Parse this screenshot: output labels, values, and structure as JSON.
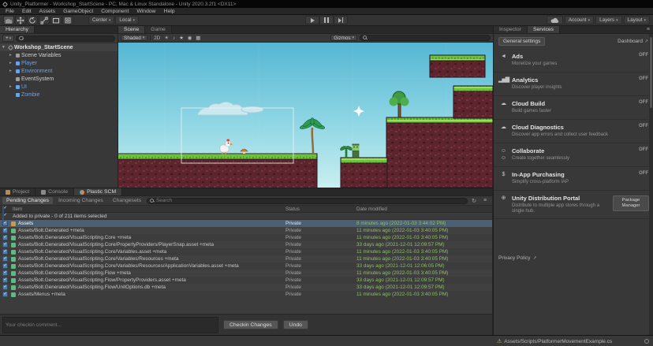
{
  "window": {
    "title": "Unity_Platformer - Workshop_StartScene - PC, Mac & Linux Standalone - Unity 2020.3.2f1 <DX11>"
  },
  "menu": {
    "items": [
      "File",
      "Edit",
      "Assets",
      "GameObject",
      "Component",
      "Window",
      "Help"
    ]
  },
  "toolbar": {
    "pivot_label": "Center",
    "space_label": "Local",
    "account_label": "Account",
    "layers_label": "Layers",
    "layout_label": "Layout"
  },
  "hierarchy": {
    "tab_label": "Hierarchy",
    "create_label": "+",
    "scene_name": "Workshop_StartScene",
    "search_placeholder": "",
    "items": [
      {
        "label": "Scene Variables",
        "label_cls": "",
        "arrow": "▸"
      },
      {
        "label": "Player",
        "label_cls": "blue",
        "arrow": "▸"
      },
      {
        "label": "Environment",
        "label_cls": "blue",
        "arrow": "▸"
      },
      {
        "label": "EventSystem",
        "label_cls": "",
        "arrow": ""
      },
      {
        "label": "UI",
        "label_cls": "blue",
        "arrow": "▸"
      },
      {
        "label": "Zombie",
        "label_cls": "blue",
        "arrow": ""
      }
    ]
  },
  "scene_view": {
    "scene_tab": "Scene",
    "game_tab": "Game",
    "draw_mode": "Shaded",
    "toggle_2d": "2D",
    "gizmos_label": "Gizmos",
    "search_placeholder": ""
  },
  "bottom_panel": {
    "project_tab": "Project",
    "console_tab": "Console",
    "plastic_tab": "Plastic SCM",
    "subtabs": [
      {
        "label": "Pending Changes",
        "cls": "active"
      },
      {
        "label": "Incoming Changes",
        "cls": ""
      },
      {
        "label": "Changesets",
        "cls": ""
      }
    ],
    "search_placeholder": "Search",
    "columns": {
      "item": "Item",
      "status": "Status",
      "date": "Date modified"
    },
    "group_row": "Added to private - 0 of 211 items selected",
    "rows": [
      {
        "item": "Assets",
        "status": "Private",
        "date": "8 minutes ago (2022-01-03 3:44:02 PM)",
        "row_cls": "selected",
        "icon_cls": "folder"
      },
      {
        "item": "Assets/Bolt.Generated +meta",
        "status": "Private",
        "date": "11 minutes ago (2022-01-03 3:40:05 PM)"
      },
      {
        "item": "Assets/Bolt.Generated/VisualScripting.Core +meta",
        "status": "Private",
        "date": "11 minutes ago (2022-01-03 3:40:05 PM)"
      },
      {
        "item": "Assets/Bolt.Generated/VisualScripting.Core/PropertyProviders/PlayerSnap.asset +meta",
        "status": "Private",
        "date": "33 days ago (2021-12-01 12:09:57 PM)"
      },
      {
        "item": "Assets/Bolt.Generated/VisualScripting.Core/Variables.asset +meta",
        "status": "Private",
        "date": "11 minutes ago (2022-01-03 3:40:05 PM)"
      },
      {
        "item": "Assets/Bolt.Generated/VisualScripting.Core/Variables/Resources +meta",
        "status": "Private",
        "date": "11 minutes ago (2022-01-03 3:40:05 PM)"
      },
      {
        "item": "Assets/Bolt.Generated/VisualScripting.Core/Variables/Resources/ApplicationVariables.asset +meta",
        "status": "Private",
        "date": "33 days ago (2021-12-01 12:06:05 PM)"
      },
      {
        "item": "Assets/Bolt.Generated/VisualScripting.Flow +meta",
        "status": "Private",
        "date": "11 minutes ago (2022-01-03 3:40:05 PM)"
      },
      {
        "item": "Assets/Bolt.Generated/VisualScripting.Flow/PropertyProviders.asset +meta",
        "status": "Private",
        "date": "33 days ago (2021-12-01 12:09:57 PM)"
      },
      {
        "item": "Assets/Bolt.Generated/VisualScripting.Flow/UnitOptions.db +meta",
        "status": "Private",
        "date": "33 days ago (2021-12-01 12:09:57 PM)"
      },
      {
        "item": "Assets/Menus +meta",
        "status": "Private",
        "date": "11 minutes ago (2022-01-03 3:40:05 PM)"
      }
    ],
    "comment_placeholder": "Your checkin comment...",
    "checkin_button": "Checkin Changes",
    "undo_button": "Undo"
  },
  "services": {
    "inspector_tab": "Inspector",
    "services_tab": "Services",
    "general_settings_label": "General settings",
    "dashboard_label": "Dashboard",
    "items": [
      {
        "name": "Ads",
        "desc": "Monetize your games",
        "status": "OFF",
        "icon": "megaphone-icon",
        "glyph": "◄"
      },
      {
        "name": "Analytics",
        "desc": "Discover player insights",
        "status": "OFF",
        "icon": "bar-chart-icon",
        "glyph": "▂▅▇"
      },
      {
        "name": "Cloud Build",
        "desc": "Build games faster",
        "status": "OFF",
        "icon": "cloud-icon",
        "glyph": "☁"
      },
      {
        "name": "Cloud Diagnostics",
        "desc": "Discover app errors and collect user feedback",
        "status": "OFF",
        "icon": "cloud-icon",
        "glyph": "☁"
      },
      {
        "name": "Collaborate",
        "desc": "Create together seamlessly",
        "status": "OFF",
        "icon": "people-icon",
        "glyph": "☺☺"
      },
      {
        "name": "In-App Purchasing",
        "desc": "Simplify cross-platform IAP",
        "status": "OFF",
        "icon": "dollar-icon",
        "glyph": "$"
      }
    ],
    "udp": {
      "name": "Unity Distribution Portal",
      "desc": "Distribute to multiple app stores through a single hub.",
      "button": "Package Manager",
      "glyph": "⊕"
    },
    "privacy_label": "Privacy Policy"
  },
  "status_bar": {
    "message": "Assets/Scripts/PlatformerMovementExample.cs"
  }
}
